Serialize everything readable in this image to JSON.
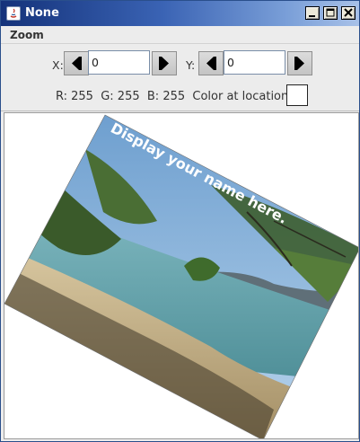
{
  "window": {
    "title": "None",
    "controls": [
      "minimize",
      "maximize",
      "close"
    ]
  },
  "menu": {
    "items": [
      "Zoom"
    ]
  },
  "coordinates": {
    "x_label": "X:",
    "x_value": "0",
    "y_label": "Y:",
    "y_value": "0"
  },
  "color_info": {
    "text": "R: 255  G: 255  B: 255  Color at location:",
    "swatch_color": "#ffffff"
  },
  "picture": {
    "overlay_text": "Display your name here."
  },
  "icons": {
    "app": "java-icon",
    "left": "arrow-left-icon",
    "right": "arrow-right-icon"
  }
}
